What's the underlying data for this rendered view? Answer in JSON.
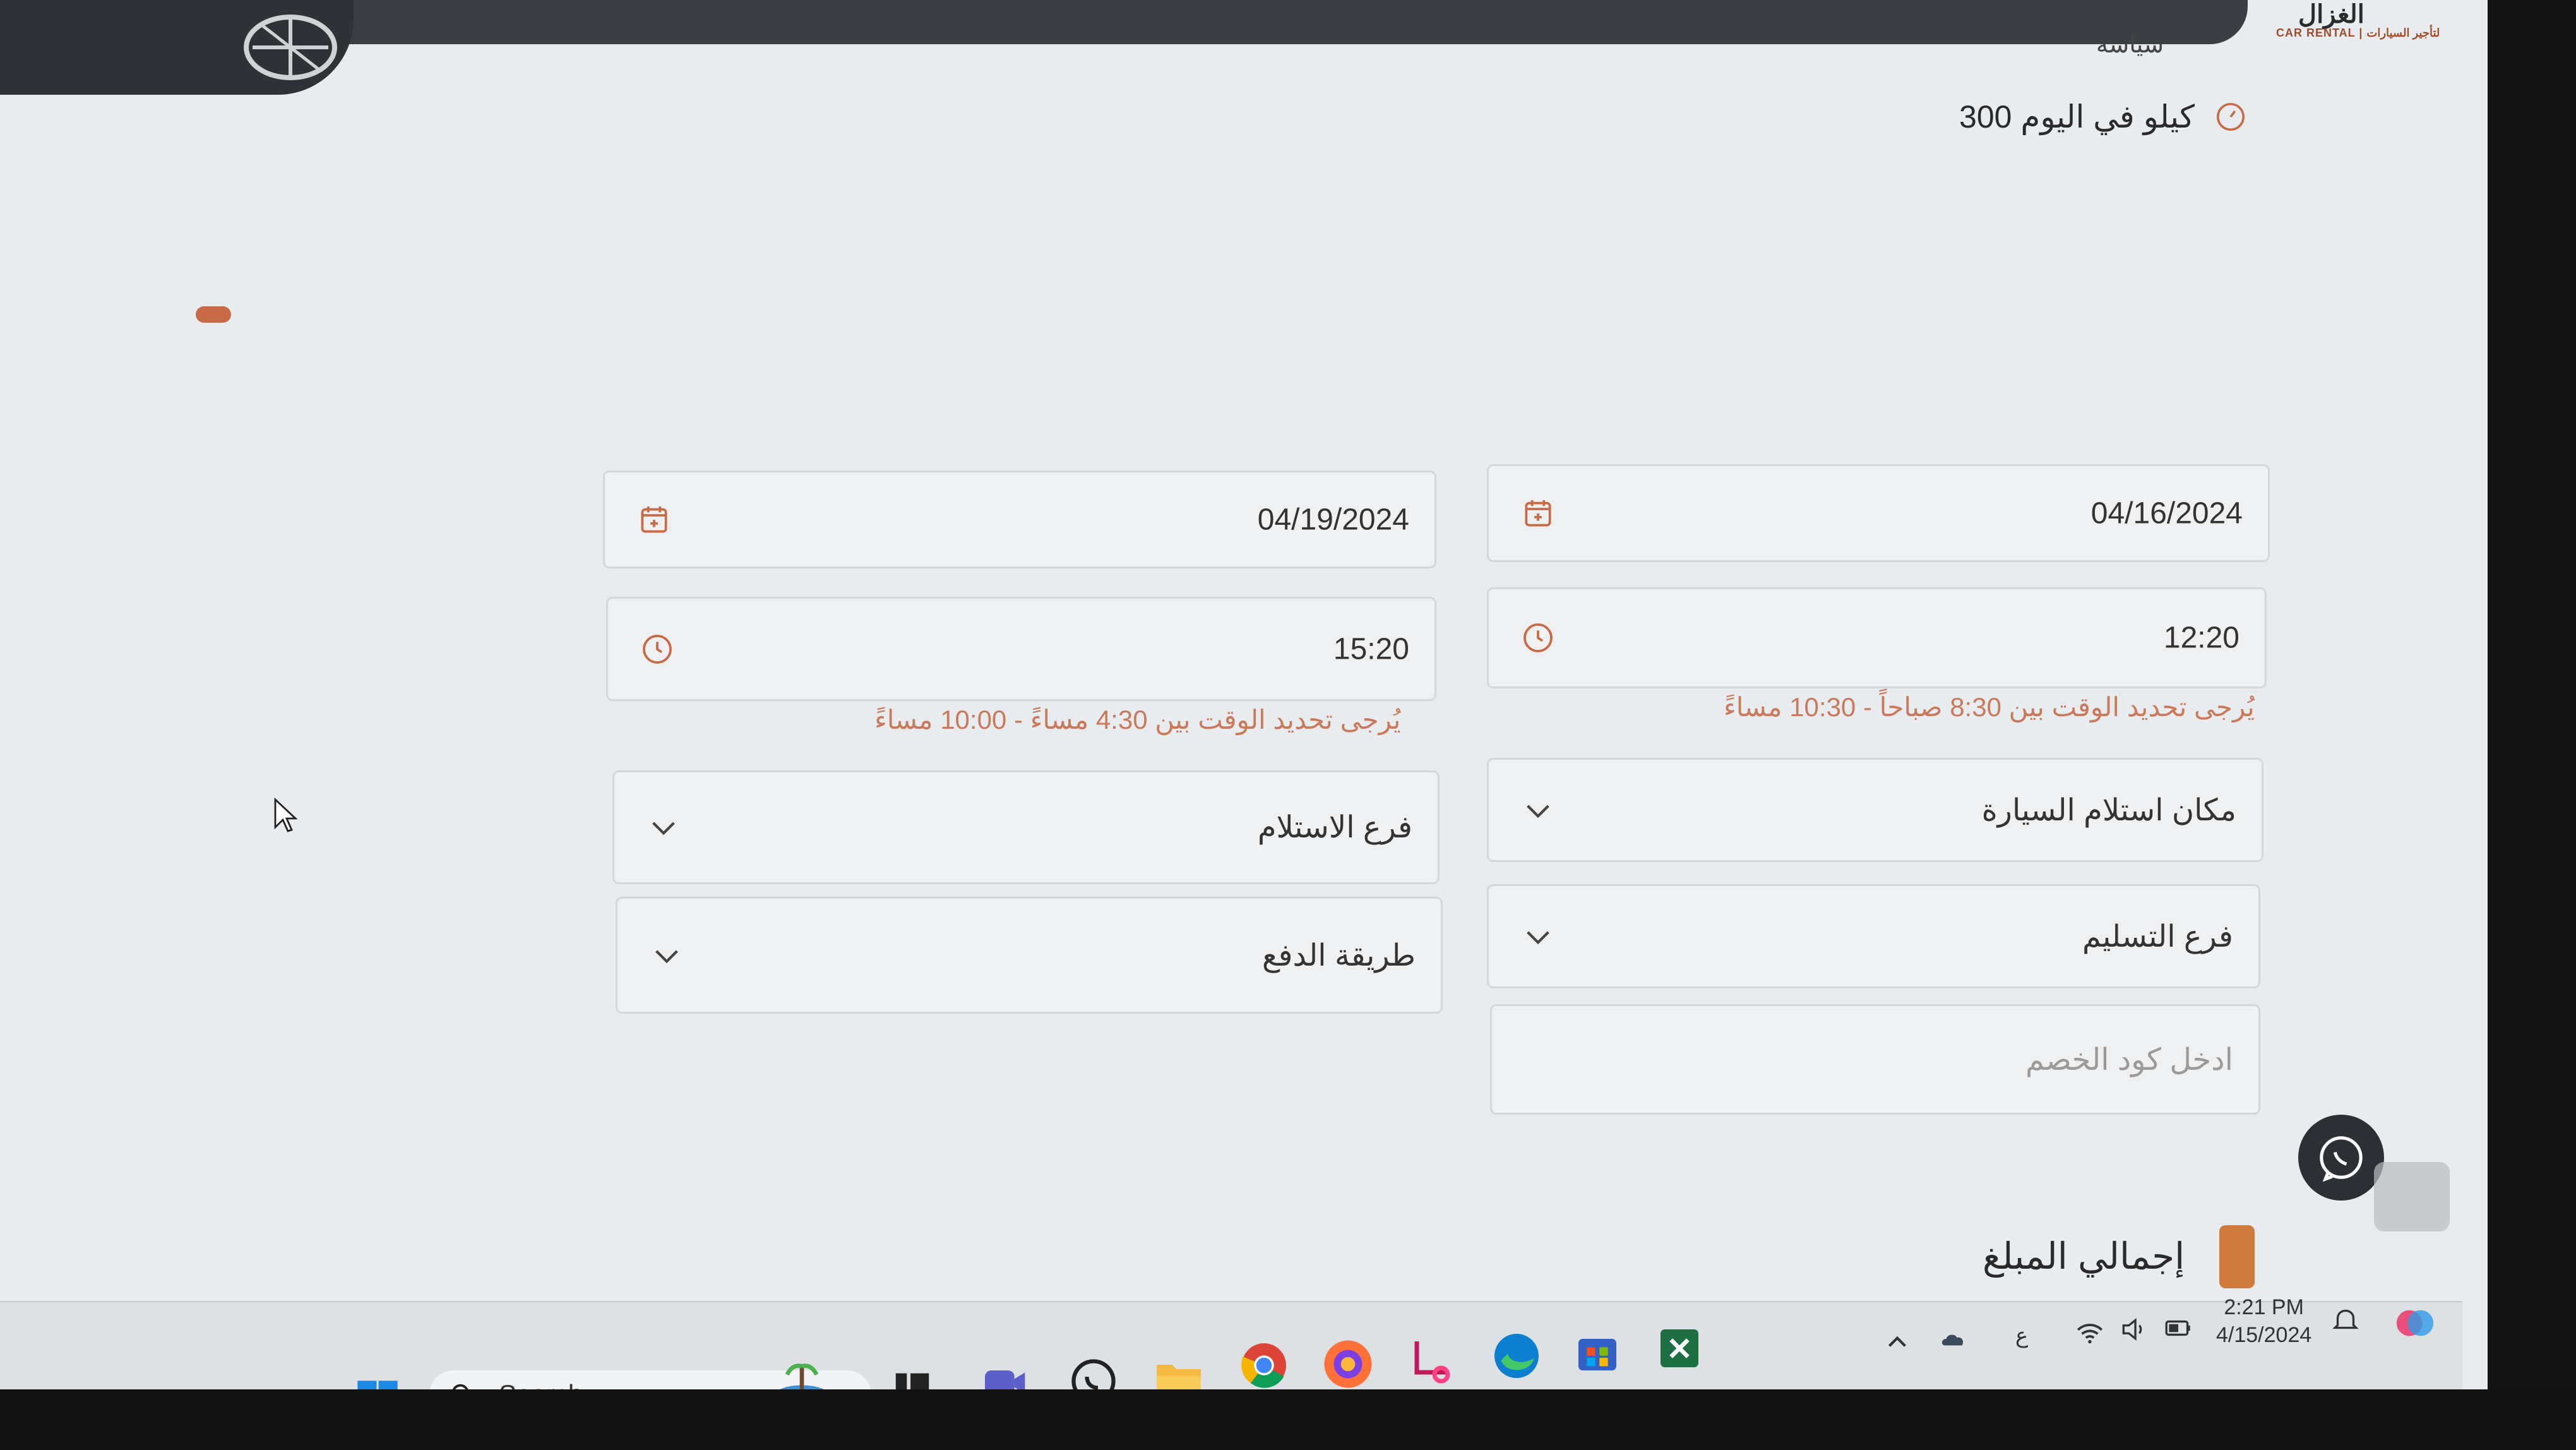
{
  "header": {
    "logo_main": "الغزال",
    "logo_sub": "CAR RENTAL | لتأجير السيارات",
    "nav_label": "سياسة"
  },
  "mileage": {
    "text": "300 كيلو في اليوم",
    "icon": "speedometer-icon"
  },
  "form": {
    "pickup_date": {
      "value": "04/16/2024",
      "icon": "calendar-icon"
    },
    "return_date": {
      "value": "04/19/2024",
      "icon": "calendar-icon"
    },
    "pickup_time": {
      "value": "12:20",
      "icon": "clock-icon"
    },
    "return_time": {
      "value": "15:20",
      "icon": "clock-icon"
    },
    "pickup_hint": "يُرجى تحديد الوقت بين 8:30 صباحاً - 10:30 مساءً",
    "return_hint": "يُرجى تحديد الوقت بين 4:30 مساءً - 10:00 مساءً",
    "pickup_location": {
      "label": "مكان استلام السيارة",
      "icon": "chevron-down-icon"
    },
    "return_branch": {
      "label": "فرع الاستلام",
      "icon": "chevron-down-icon"
    },
    "delivery_branch": {
      "label": "فرع التسليم",
      "icon": "chevron-down-icon"
    },
    "payment_method": {
      "label": "طريقة الدفع",
      "icon": "chevron-down-icon"
    },
    "discount_code": {
      "placeholder": "ادخل كود الخصم"
    }
  },
  "summary": {
    "total_label": "إجمالي المبلغ"
  },
  "colors": {
    "accent": "#c86a45",
    "hint": "#c97a5c",
    "border": "#d4d8dc"
  },
  "taskbar": {
    "search_label": "Search",
    "time": "2:21 PM",
    "date": "4/15/2024",
    "lang": "ع",
    "apps": [
      "windows-start-icon",
      "widgets-icon",
      "task-view-icon",
      "teams-icon",
      "whatsapp-icon",
      "file-explorer-icon",
      "chrome-icon",
      "firefox-icon",
      "snipping-tool-icon",
      "edge-icon",
      "store-icon",
      "excel-icon"
    ]
  }
}
